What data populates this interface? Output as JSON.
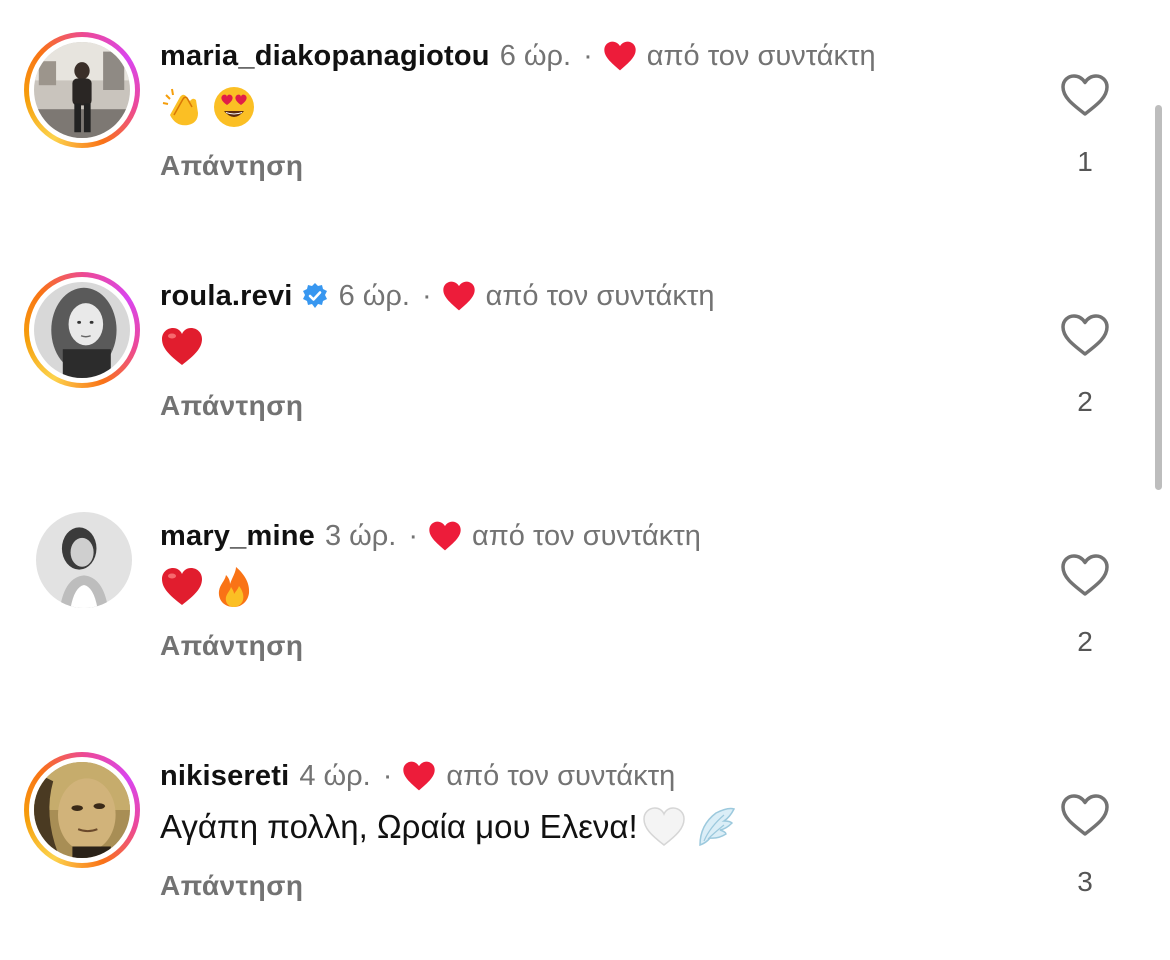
{
  "comments": [
    {
      "username": "maria_diakopanagiotou",
      "time": "6 ώρ.",
      "separator": "·",
      "creator_like": "από τον συντάκτη",
      "body_emojis": [
        "clapping-hands-emoji",
        "heart-eyes-emoji"
      ],
      "body_text": "",
      "reply": "Απάντηση",
      "likes": "1",
      "verified": false,
      "story_ring": true
    },
    {
      "username": "roula.revi",
      "time": "6 ώρ.",
      "separator": "·",
      "creator_like": "από τον συντάκτη",
      "body_emojis": [
        "red-heart-emoji"
      ],
      "body_text": "",
      "reply": "Απάντηση",
      "likes": "2",
      "verified": true,
      "story_ring": true
    },
    {
      "username": "mary_mine",
      "time": "3 ώρ.",
      "separator": "·",
      "creator_like": "από τον συντάκτη",
      "body_emojis": [
        "red-heart-emoji",
        "fire-emoji"
      ],
      "body_text": "",
      "reply": "Απάντηση",
      "likes": "2",
      "verified": false,
      "story_ring": false
    },
    {
      "username": "nikisereti",
      "time": "4 ώρ.",
      "separator": "·",
      "creator_like": "από τον συντάκτη",
      "body_emojis": [
        "white-heart-emoji",
        "wing-emoji"
      ],
      "body_text": "Αγάπη πολλη, Ωραία μου Ελενα!",
      "reply": "Απάντηση",
      "likes": "3",
      "verified": false,
      "story_ring": true
    }
  ],
  "colors": {
    "creator_heart": "#ed1c3a",
    "verified_badge": "#3897f0",
    "meta_gray": "#737373"
  }
}
